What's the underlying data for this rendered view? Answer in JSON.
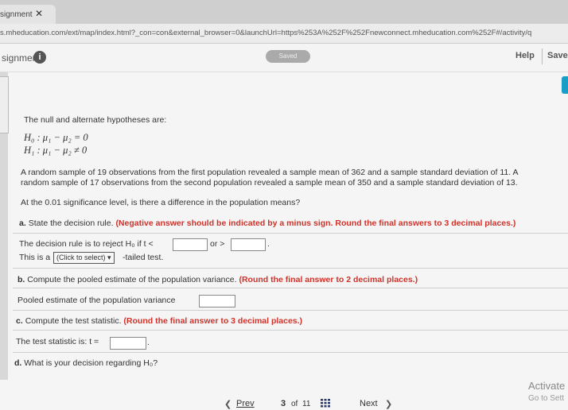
{
  "browser": {
    "tab_title": "signment",
    "tab_close": "✕",
    "url": "s.mheducation.com/ext/map/index.html?_con=con&external_browser=0&launchUrl=https%253A%252F%252Fnewconnect.mheducation.com%252F#/activity/q"
  },
  "header": {
    "title": "signment",
    "info": "i",
    "saved": "Saved",
    "help": "Help",
    "save": "Save"
  },
  "question": {
    "intro": "The null and alternate hypotheses are:",
    "h0": "H₀ : μ₁ − μ₂ = 0",
    "h1": "H₁ : μ₁ − μ₂ ≠ 0",
    "sample_line1": "A random sample of 19 observations from the first population revealed a sample mean of 362 and a sample standard deviation of 11. A",
    "sample_line2": "random sample of 17 observations from the second population revealed a sample mean of 350 and a sample standard deviation of 13.",
    "significance": "At the 0.01 significance level, is there a difference in the population means?"
  },
  "part_a": {
    "label": "a.",
    "text": "State the decision rule.",
    "note": "(Negative answer should be indicated by a minus sign. Round the final answers to 3 decimal places.)",
    "rule_prefix": "The decision rule is to reject H₀ if t <",
    "rule_or": "or >",
    "rule_end": ".",
    "tailed_prefix": "This is a",
    "tailed_select": "(Click to select)",
    "tailed_suffix": "-tailed test."
  },
  "part_b": {
    "label": "b.",
    "text": "Compute the pooled estimate of the population variance.",
    "note": "(Round the final answer to 2 decimal places.)",
    "field_label": "Pooled estimate of the population variance"
  },
  "part_c": {
    "label": "c.",
    "text": "Compute the test statistic.",
    "note": "(Round the final answer to 3 decimal places.)",
    "field_label": "The test statistic is: t =",
    "field_end": "."
  },
  "part_d": {
    "label": "d.",
    "text": "What is your decision regarding H₀?"
  },
  "footer": {
    "prev": "Prev",
    "page_current": "3",
    "page_of": "of",
    "page_total": "11",
    "next": "Next",
    "activate": "Activate",
    "goto": "Go to Sett"
  }
}
